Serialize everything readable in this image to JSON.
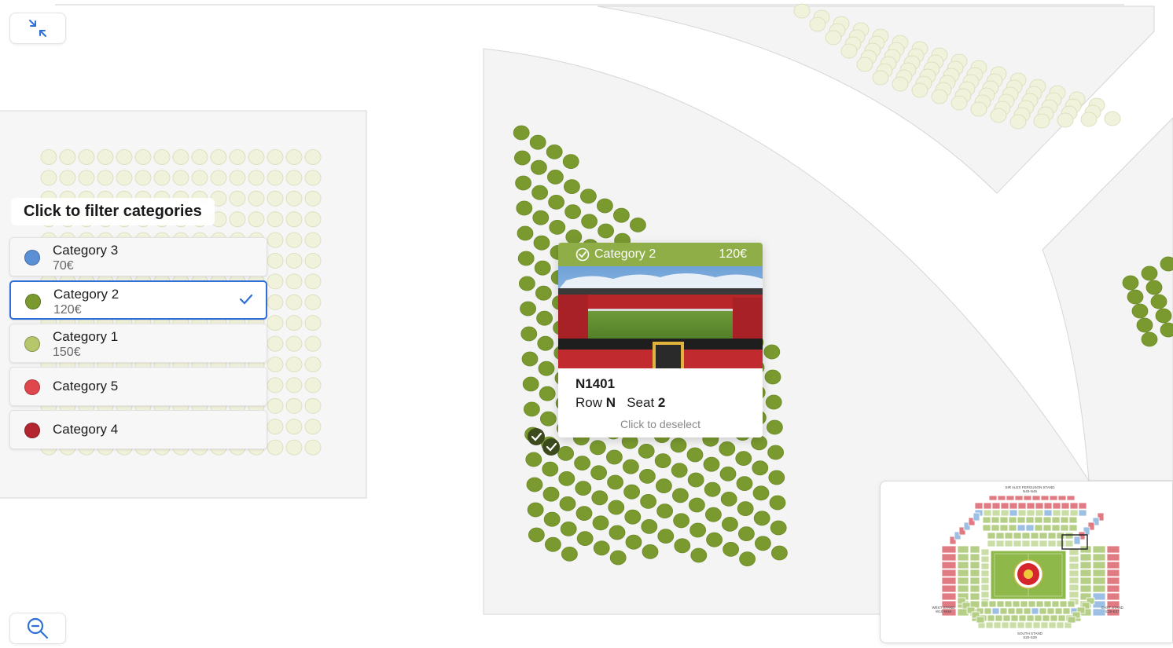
{
  "controls": {
    "collapse_icon": "collapse-arrows-icon",
    "zoom_out_icon": "zoom-out-icon"
  },
  "filter": {
    "title": "Click to filter categories",
    "categories": [
      {
        "name": "Category 3",
        "price": "70€",
        "color": "#5b8fd6",
        "selected": false
      },
      {
        "name": "Category 2",
        "price": "120€",
        "color": "#7a9a30",
        "selected": true
      },
      {
        "name": "Category 1",
        "price": "150€",
        "color": "#b5c76a",
        "selected": false
      },
      {
        "name": "Category 5",
        "price": "",
        "color": "#e0474c",
        "selected": false
      },
      {
        "name": "Category 4",
        "price": "",
        "color": "#b3262f",
        "selected": false
      }
    ]
  },
  "popup": {
    "category": "Category 2",
    "price": "120€",
    "seat_code": "N1401",
    "row_label": "Row",
    "row_value": "N",
    "seat_label": "Seat",
    "seat_value": "2",
    "hint": "Click to deselect"
  },
  "minimap": {
    "north_stand": "SIR ALEX FERGUSON STAND",
    "north_sub": "N40-N46",
    "west_stand": "WEST STAND",
    "west_sub": "W10-W16",
    "east_stand": "EAST STAND",
    "east_sub": "E30-E37",
    "south_stand": "SOUTH STAND",
    "south_sub": "S20-S29"
  },
  "colors": {
    "selected_seat": "#7a9a30",
    "unavailable_seat": "#f1f2dc",
    "accent": "#2f6fd6",
    "checked_seat": "#3c4a1e"
  }
}
